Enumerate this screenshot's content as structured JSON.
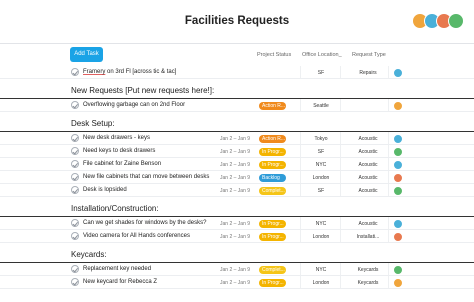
{
  "header": {
    "title": "Facilities Requests",
    "avatar_colors": [
      "#f0a53c",
      "#4ab0d9",
      "#e8794f",
      "#58b86a"
    ]
  },
  "toolbar": {
    "add_task_label": "Add Task",
    "columns": {
      "project_status": "Project Status",
      "office_location": "Office Location_",
      "request_type": "Request Type"
    }
  },
  "colors": {
    "accent": "#1aa3e6",
    "status_action": "#f08a1c",
    "status_in_progress": "#f4b400",
    "status_backlog": "#2f9cd8",
    "status_complete": "#f5c518"
  },
  "top_row": {
    "name_part1": "Framery",
    "name_part2": " on 3rd Fl [across tic & tac]",
    "dates": "",
    "status": "",
    "office": "SF",
    "type": "Repairs",
    "avatar_color": "#4ab0d9"
  },
  "sections": [
    {
      "title": "New Requests [Put new requests here!]:",
      "rows": [
        {
          "name": "Overflowing garbage can on 2nd Floor",
          "dates": "",
          "status": "Action R...",
          "status_color": "#f08a1c",
          "office": "Seattle",
          "type": "",
          "avatar_color": "#f0a53c"
        }
      ]
    },
    {
      "title": "Desk Setup:",
      "rows": [
        {
          "name": "New desk drawers - keys",
          "dates": "Jan 2 – Jan 9",
          "status": "Action R...",
          "status_color": "#f08a1c",
          "office": "Tokyo",
          "type": "Acoustic",
          "avatar_color": "#4ab0d9"
        },
        {
          "name": "Need keys to desk drawers",
          "dates": "Jan 2 – Jan 9",
          "status": "In Progr...",
          "status_color": "#f4b400",
          "office": "SF",
          "type": "Acoustic",
          "avatar_color": "#58b86a"
        },
        {
          "name": "File cabinet for Zaine Benson",
          "dates": "Jan 2 – Jan 9",
          "status": "In Progr...",
          "status_color": "#f4b400",
          "office": "NYC",
          "type": "Acoustic",
          "avatar_color": "#4ab0d9"
        },
        {
          "name": "New file cabinets that can move between desks",
          "dates": "Jan 2 – Jan 9",
          "status": "Backlog",
          "status_color": "#2f9cd8",
          "office": "London",
          "type": "Acoustic",
          "avatar_color": "#e8794f"
        },
        {
          "name": "Desk is lopsided",
          "dates": "Jan 2 – Jan 9",
          "status": "Complet...",
          "status_color": "#f5c518",
          "office": "SF",
          "type": "Acoustic",
          "avatar_color": "#58b86a"
        }
      ]
    },
    {
      "title": "Installation/Construction:",
      "rows": [
        {
          "name": "Can we get shades for windows by the desks?",
          "dates": "Jan 2 – Jan 9",
          "status": "In Progr...",
          "status_color": "#f4b400",
          "office": "NYC",
          "type": "Acoustic",
          "avatar_color": "#4ab0d9"
        },
        {
          "name": "Video camera for All Hands conferences",
          "dates": "Jan 2 – Jan 9",
          "status": "In Progr...",
          "status_color": "#f4b400",
          "office": "London",
          "type": "Installati...",
          "avatar_color": "#e8794f"
        }
      ]
    },
    {
      "title": "Keycards:",
      "rows": [
        {
          "name": "Replacement key needed",
          "dates": "Jan 2 – Jan 9",
          "status": "Complet...",
          "status_color": "#f5c518",
          "office": "NYC",
          "type": "Keycards",
          "avatar_color": "#58b86a"
        },
        {
          "name": "New keycard for Rebecca Z",
          "dates": "Jan 2 – Jan 9",
          "status": "In Progr...",
          "status_color": "#f4b400",
          "office": "London",
          "type": "Keycards",
          "avatar_color": "#f0a53c"
        }
      ]
    }
  ]
}
